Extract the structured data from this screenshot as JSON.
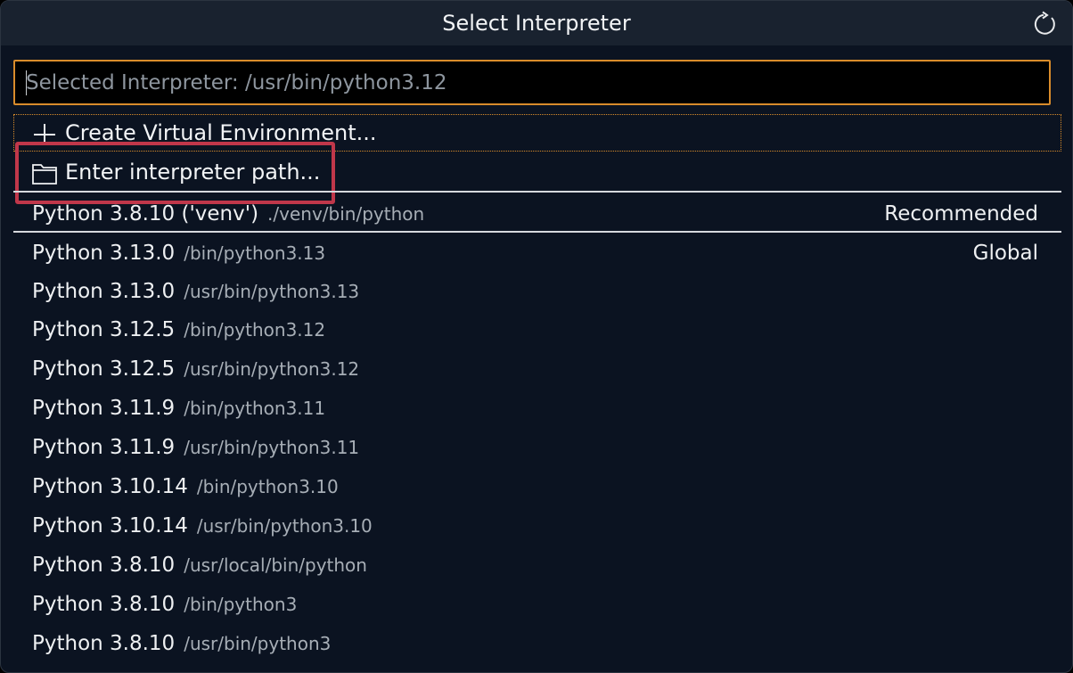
{
  "dialog": {
    "title": "Select Interpreter",
    "refresh_icon": "refresh-icon"
  },
  "search": {
    "placeholder": "Selected Interpreter: /usr/bin/python3.12",
    "value": ""
  },
  "actions": [
    {
      "icon": "plus-icon",
      "label": "Create Virtual Environment..."
    },
    {
      "icon": "folder-icon",
      "label": "Enter interpreter path..."
    }
  ],
  "recommended": {
    "name": "Python 3.8.10 ('venv')",
    "path": "./venv/bin/python",
    "tag": "Recommended"
  },
  "interpreters": [
    {
      "name": "Python 3.13.0",
      "path": "/bin/python3.13",
      "tag": "Global"
    },
    {
      "name": "Python 3.13.0",
      "path": "/usr/bin/python3.13",
      "tag": ""
    },
    {
      "name": "Python 3.12.5",
      "path": "/bin/python3.12",
      "tag": ""
    },
    {
      "name": "Python 3.12.5",
      "path": "/usr/bin/python3.12",
      "tag": ""
    },
    {
      "name": "Python 3.11.9",
      "path": "/bin/python3.11",
      "tag": ""
    },
    {
      "name": "Python 3.11.9",
      "path": "/usr/bin/python3.11",
      "tag": ""
    },
    {
      "name": "Python 3.10.14",
      "path": "/bin/python3.10",
      "tag": ""
    },
    {
      "name": "Python 3.10.14",
      "path": "/usr/bin/python3.10",
      "tag": ""
    },
    {
      "name": "Python 3.8.10",
      "path": "/usr/local/bin/python",
      "tag": ""
    },
    {
      "name": "Python 3.8.10",
      "path": "/bin/python3",
      "tag": ""
    },
    {
      "name": "Python 3.8.10",
      "path": "/usr/bin/python3",
      "tag": ""
    }
  ],
  "colors": {
    "accent": "#d98c2b",
    "highlight": "#c0374a",
    "background": "#0b1321",
    "titlebar": "#19222f"
  }
}
